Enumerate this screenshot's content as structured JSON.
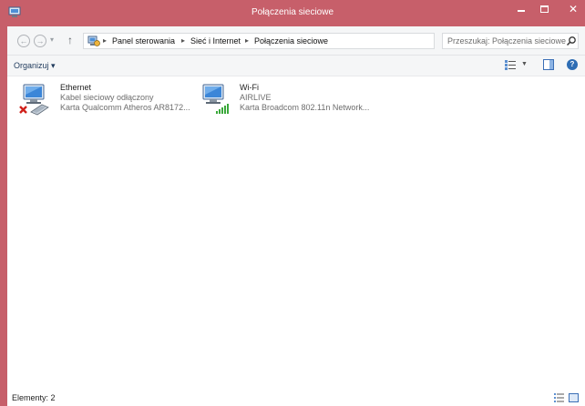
{
  "window": {
    "title": "Połączenia sieciowe",
    "colors": {
      "frame": "#c75f6a",
      "client": "#ffffff",
      "chrome": "#f5f6f7",
      "link": "#1e395b"
    }
  },
  "nav": {
    "back_icon": "back-arrow-icon",
    "forward_icon": "forward-arrow-icon",
    "up_icon": "up-arrow-icon"
  },
  "address": {
    "crumbs": [
      "Panel sterowania",
      "Sieć i Internet",
      "Połączenia sieciowe"
    ]
  },
  "search": {
    "placeholder": "Przeszukaj: Połączenia sieciowe"
  },
  "toolbar": {
    "organize_label": "Organizuj ▾"
  },
  "connections": [
    {
      "name": "Ethernet",
      "status": "Kabel sieciowy odłączony",
      "device": "Karta Qualcomm Atheros AR8172...",
      "icon": "ethernet-disconnected-icon"
    },
    {
      "name": "Wi-Fi",
      "status": "AIRLIVE",
      "device": "Karta Broadcom 802.11n Network...",
      "icon": "wifi-connected-icon"
    }
  ],
  "statusbar": {
    "count_label": "Elementy: 2"
  }
}
